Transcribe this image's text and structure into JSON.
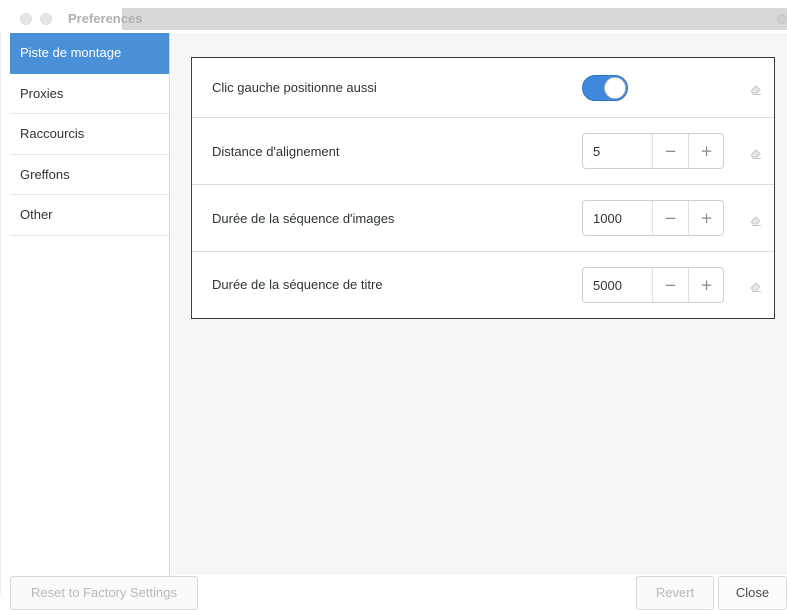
{
  "window": {
    "title": "Preferences"
  },
  "sidebar": {
    "items": [
      {
        "label": "Piste de montage",
        "active": true
      },
      {
        "label": "Proxies",
        "active": false
      },
      {
        "label": "Raccourcis",
        "active": false
      },
      {
        "label": "Greffons",
        "active": false
      },
      {
        "label": "Other",
        "active": false
      }
    ]
  },
  "settings": {
    "rows": [
      {
        "label": "Clic gauche positionne aussi",
        "control": "toggle",
        "enabled": true
      },
      {
        "label": "Distance d'alignement",
        "control": "spin",
        "value": "5"
      },
      {
        "label": "Durée de la séquence d'images",
        "control": "spin",
        "value": "1000"
      },
      {
        "label": "Durée de la séquence de titre",
        "control": "spin",
        "value": "5000"
      }
    ],
    "minus_glyph": "−",
    "plus_glyph": "+",
    "reset_icon": "eraser-icon"
  },
  "footer": {
    "reset_label": "Reset to Factory Settings",
    "revert_label": "Revert",
    "close_label": "Close"
  },
  "colors": {
    "accent": "#4a90d9",
    "toggle_on": "#3f88dc"
  }
}
